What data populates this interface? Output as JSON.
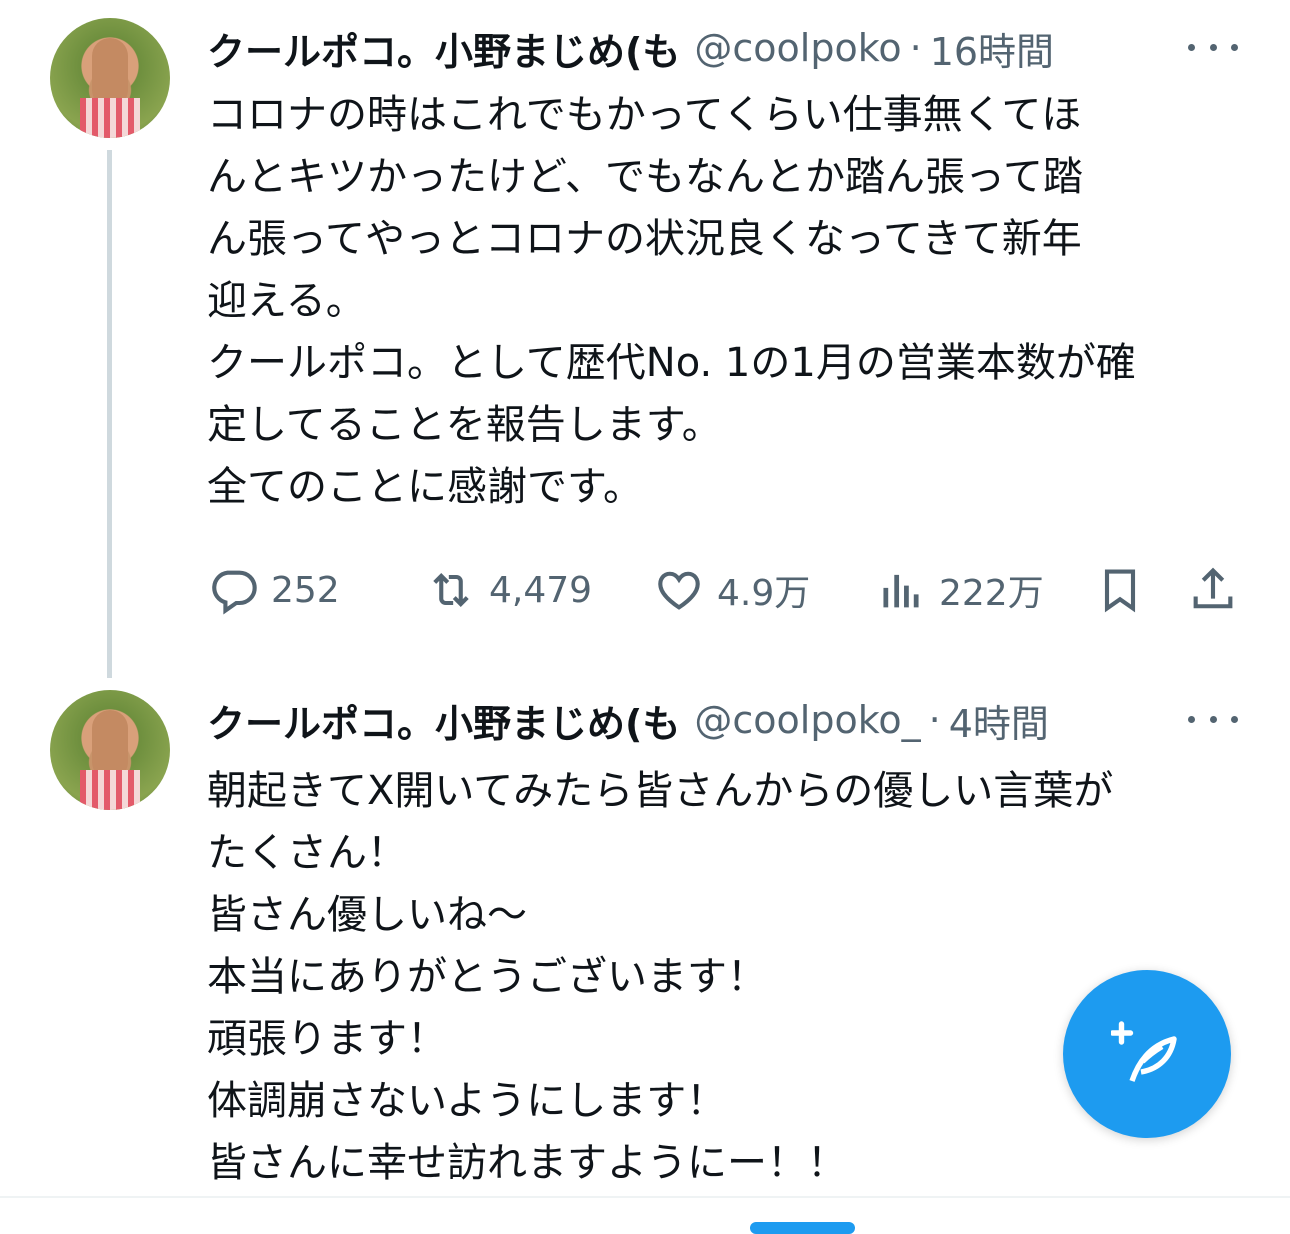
{
  "tweets": [
    {
      "name": "クールポコ。小野まじめ(も",
      "handle": "@coolpoko",
      "dot": "·",
      "time": "16時間",
      "avatar_icon": "profile-photo",
      "text": "コロナの時はこれでもかってくらい仕事無くてほ\nんとキツかったけど、でもなんとか踏ん張って踏\nん張ってやっとコロナの状況良くなってきて新年\n迎える。\nクールポコ。として歴代No. 1の1月の営業本数が確\n定してることを報告します。\n全てのことに感謝です。",
      "actions": {
        "replies": "252",
        "retweets": "4,479",
        "likes": "4.9万",
        "views": "222万"
      }
    },
    {
      "name": "クールポコ。小野まじめ(も",
      "handle": "@coolpoko_",
      "dot": "·",
      "time": "4時間",
      "avatar_icon": "profile-photo",
      "text": "朝起きてX開いてみたら皆さんからの優しい言葉が\nたくさん！\n皆さん優しいね〜\n本当にありがとうございます！\n頑張ります！\n体調崩さないようにします！\n皆さんに幸せ訪れますようにー！！"
    }
  ],
  "icons": {
    "reply": "reply-icon",
    "retweet": "retweet-icon",
    "like": "heart-icon",
    "views": "views-chart-icon",
    "bookmark": "bookmark-icon",
    "share": "share-icon",
    "more": "more-icon",
    "compose": "compose-feather-icon"
  },
  "colors": {
    "accent": "#1d9bf0",
    "text_primary": "#0f1419",
    "text_secondary": "#536471",
    "thread_line": "#cfd9de"
  }
}
